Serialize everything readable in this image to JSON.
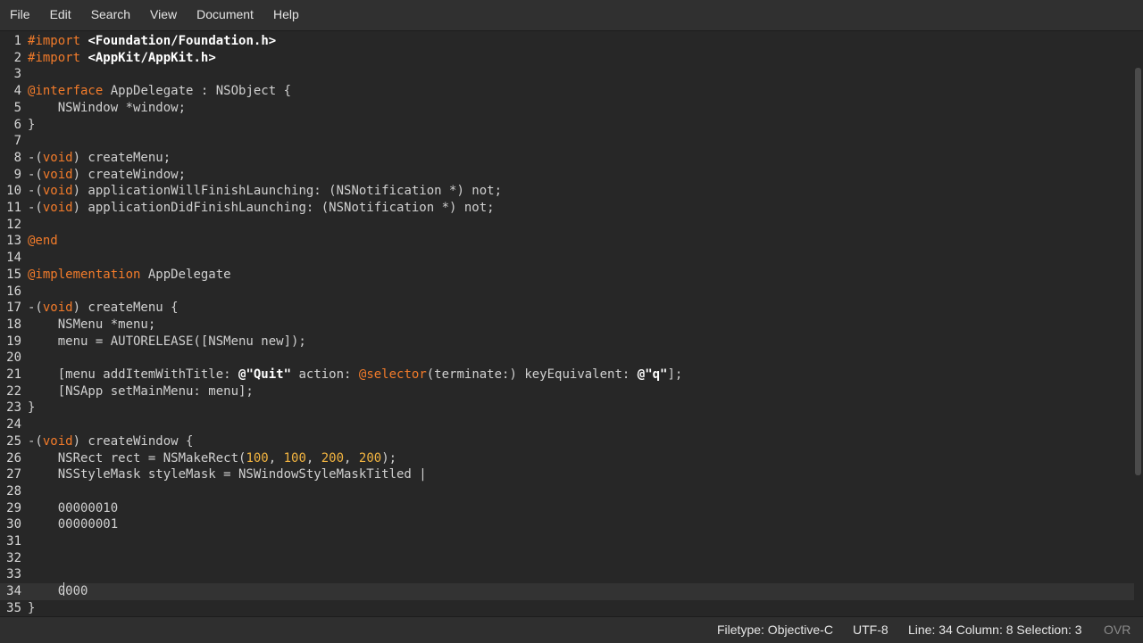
{
  "menu": [
    "File",
    "Edit",
    "Search",
    "View",
    "Document",
    "Help"
  ],
  "editor": {
    "current_line": 34,
    "lines": [
      {
        "n": "1",
        "tokens": [
          {
            "t": "#import",
            "c": "kw"
          },
          {
            "t": " "
          },
          {
            "t": "<Foundation/Foundation.h>",
            "c": "inc"
          }
        ]
      },
      {
        "n": "2",
        "tokens": [
          {
            "t": "#import",
            "c": "kw"
          },
          {
            "t": " "
          },
          {
            "t": "<AppKit/AppKit.h>",
            "c": "inc"
          }
        ]
      },
      {
        "n": "3",
        "tokens": []
      },
      {
        "n": "4",
        "tokens": [
          {
            "t": "@interface",
            "c": "kw"
          },
          {
            "t": " AppDelegate : NSObject {"
          }
        ]
      },
      {
        "n": "5",
        "tokens": [
          {
            "t": "    NSWindow *window;"
          }
        ]
      },
      {
        "n": "6",
        "tokens": [
          {
            "t": "}"
          }
        ]
      },
      {
        "n": "7",
        "tokens": []
      },
      {
        "n": "8",
        "tokens": [
          {
            "t": "-("
          },
          {
            "t": "void",
            "c": "kw"
          },
          {
            "t": ") createMenu;"
          }
        ]
      },
      {
        "n": "9",
        "tokens": [
          {
            "t": "-("
          },
          {
            "t": "void",
            "c": "kw"
          },
          {
            "t": ") createWindow;"
          }
        ]
      },
      {
        "n": "10",
        "tokens": [
          {
            "t": "-("
          },
          {
            "t": "void",
            "c": "kw"
          },
          {
            "t": ") applicationWillFinishLaunching: (NSNotification *) not;"
          }
        ]
      },
      {
        "n": "11",
        "tokens": [
          {
            "t": "-("
          },
          {
            "t": "void",
            "c": "kw"
          },
          {
            "t": ") applicationDidFinishLaunching: (NSNotification *) not;"
          }
        ]
      },
      {
        "n": "12",
        "tokens": []
      },
      {
        "n": "13",
        "tokens": [
          {
            "t": "@end",
            "c": "kw"
          }
        ]
      },
      {
        "n": "14",
        "tokens": []
      },
      {
        "n": "15",
        "tokens": [
          {
            "t": "@implementation",
            "c": "kw"
          },
          {
            "t": " AppDelegate"
          }
        ]
      },
      {
        "n": "16",
        "tokens": []
      },
      {
        "n": "17",
        "tokens": [
          {
            "t": "-("
          },
          {
            "t": "void",
            "c": "kw"
          },
          {
            "t": ") createMenu {"
          }
        ]
      },
      {
        "n": "18",
        "tokens": [
          {
            "t": "    NSMenu *menu;"
          }
        ]
      },
      {
        "n": "19",
        "tokens": [
          {
            "t": "    menu = AUTORELEASE([NSMenu new]);"
          }
        ]
      },
      {
        "n": "20",
        "tokens": []
      },
      {
        "n": "21",
        "tokens": [
          {
            "t": "    [menu addItemWithTitle: "
          },
          {
            "t": "@\"Quit\"",
            "c": "str"
          },
          {
            "t": " action: "
          },
          {
            "t": "@selector",
            "c": "kw"
          },
          {
            "t": "(terminate:) keyEquivalent: "
          },
          {
            "t": "@\"q\"",
            "c": "str"
          },
          {
            "t": "];"
          }
        ]
      },
      {
        "n": "22",
        "tokens": [
          {
            "t": "    [NSApp setMainMenu: menu];"
          }
        ]
      },
      {
        "n": "23",
        "tokens": [
          {
            "t": "}"
          }
        ]
      },
      {
        "n": "24",
        "tokens": []
      },
      {
        "n": "25",
        "tokens": [
          {
            "t": "-("
          },
          {
            "t": "void",
            "c": "kw"
          },
          {
            "t": ") createWindow {"
          }
        ]
      },
      {
        "n": "26",
        "tokens": [
          {
            "t": "    NSRect rect = NSMakeRect("
          },
          {
            "t": "100",
            "c": "num"
          },
          {
            "t": ", "
          },
          {
            "t": "100",
            "c": "num"
          },
          {
            "t": ", "
          },
          {
            "t": "200",
            "c": "num"
          },
          {
            "t": ", "
          },
          {
            "t": "200",
            "c": "num"
          },
          {
            "t": ");"
          }
        ]
      },
      {
        "n": "27",
        "tokens": [
          {
            "t": "    NSStyleMask styleMask = NSWindowStyleMaskTitled |"
          }
        ]
      },
      {
        "n": "28",
        "tokens": []
      },
      {
        "n": "29",
        "tokens": [
          {
            "t": "    00000010"
          }
        ]
      },
      {
        "n": "30",
        "tokens": [
          {
            "t": "    00000001"
          }
        ]
      },
      {
        "n": "31",
        "tokens": []
      },
      {
        "n": "32",
        "tokens": []
      },
      {
        "n": "33",
        "tokens": []
      },
      {
        "n": "34",
        "tokens": [
          {
            "t": "    0000"
          }
        ]
      },
      {
        "n": "35",
        "tokens": [
          {
            "t": "}"
          }
        ]
      }
    ]
  },
  "status": {
    "filetype": "Filetype: Objective-C",
    "encoding": "UTF-8",
    "position": "Line: 34 Column: 8 Selection: 3",
    "mode": "OVR"
  },
  "colors": {
    "keyword": "#f27b2a",
    "number": "#f2b440",
    "string": "#ffffff",
    "background": "#272727"
  }
}
